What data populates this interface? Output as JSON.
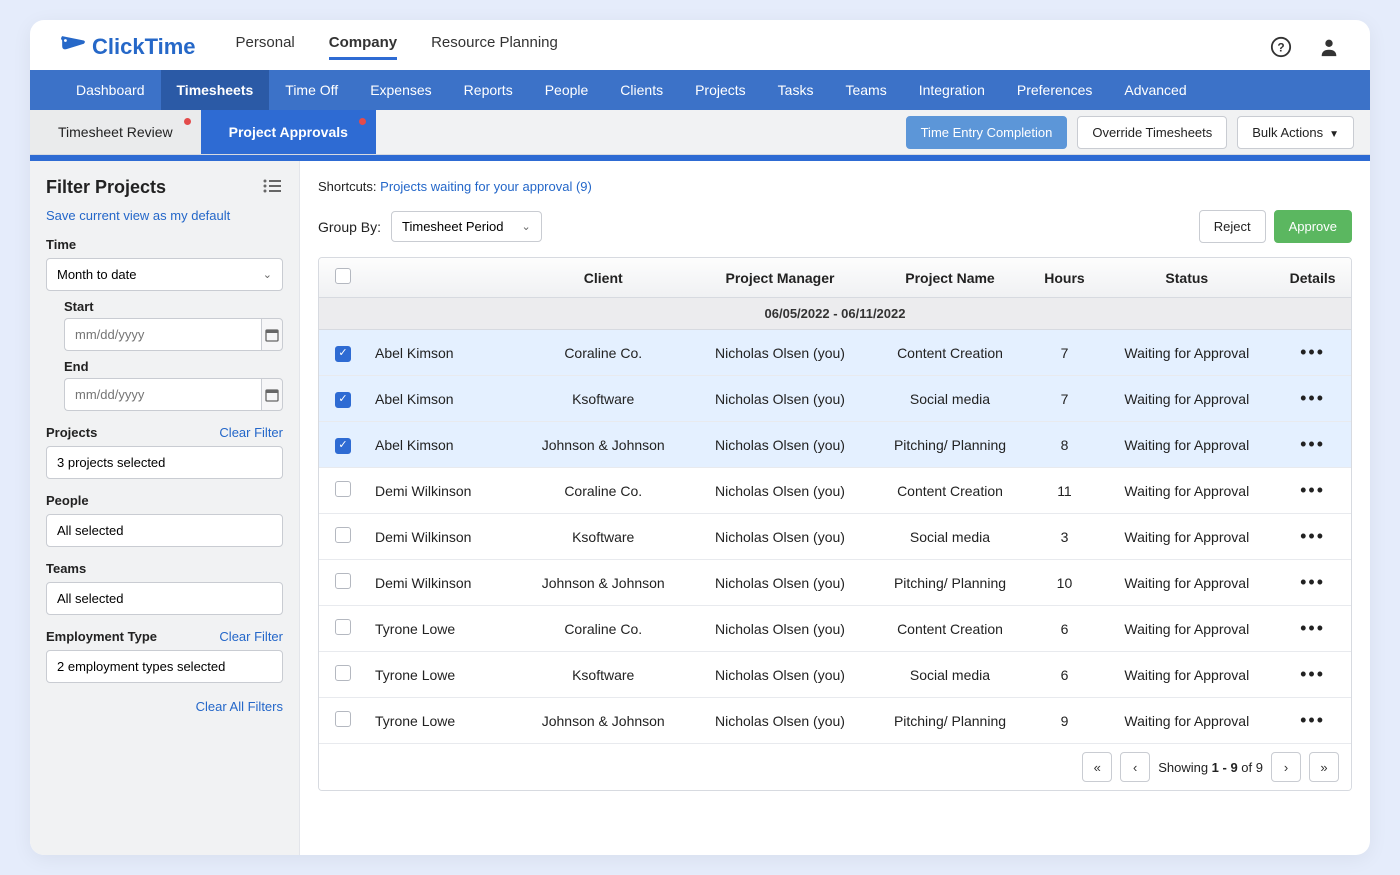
{
  "brand": "ClickTime",
  "topNav": {
    "items": [
      "Personal",
      "Company",
      "Resource Planning"
    ],
    "activeIndex": 1
  },
  "topIcons": {
    "help": "help-icon",
    "user": "user-icon"
  },
  "blueNav": {
    "items": [
      "Dashboard",
      "Timesheets",
      "Time Off",
      "Expenses",
      "Reports",
      "People",
      "Clients",
      "Projects",
      "Tasks",
      "Teams",
      "Integration",
      "Preferences",
      "Advanced"
    ],
    "activeIndex": 1
  },
  "subTabs": {
    "items": [
      {
        "label": "Timesheet Review",
        "hasDot": true
      },
      {
        "label": "Project Approvals",
        "hasDot": true
      }
    ],
    "activeIndex": 1,
    "actions": {
      "timeEntry": "Time Entry Completion",
      "override": "Override Timesheets",
      "bulk": "Bulk Actions"
    }
  },
  "sidebar": {
    "title": "Filter Projects",
    "saveView": "Save current view as my default",
    "time": {
      "label": "Time",
      "value": "Month to date",
      "start": {
        "label": "Start",
        "placeholder": "mm/dd/yyyy"
      },
      "end": {
        "label": "End",
        "placeholder": "mm/dd/yyyy"
      }
    },
    "projects": {
      "label": "Projects",
      "clear": "Clear Filter",
      "value": "3 projects selected"
    },
    "people": {
      "label": "People",
      "value": "All selected"
    },
    "teams": {
      "label": "Teams",
      "value": "All selected"
    },
    "employment": {
      "label": "Employment Type",
      "clear": "Clear Filter",
      "value": "2 employment types selected"
    },
    "clearAll": "Clear All Filters"
  },
  "main": {
    "shortcuts": {
      "label": "Shortcuts:",
      "link": "Projects waiting for your approval (9)"
    },
    "groupBy": {
      "label": "Group By:",
      "value": "Timesheet Period"
    },
    "buttons": {
      "reject": "Reject",
      "approve": "Approve"
    },
    "columns": [
      "",
      "",
      "Client",
      "Project Manager",
      "Project Name",
      "Hours",
      "Status",
      "Details"
    ],
    "groupHeader": "06/05/2022 - 06/11/2022",
    "rows": [
      {
        "selected": true,
        "person": "Abel Kimson",
        "client": "Coraline Co.",
        "manager": "Nicholas Olsen (you)",
        "project": "Content Creation",
        "hours": "7",
        "status": "Waiting for Approval"
      },
      {
        "selected": true,
        "person": "Abel Kimson",
        "client": "Ksoftware",
        "manager": "Nicholas Olsen (you)",
        "project": "Social media",
        "hours": "7",
        "status": "Waiting for Approval"
      },
      {
        "selected": true,
        "person": "Abel Kimson",
        "client": "Johnson & Johnson",
        "manager": "Nicholas Olsen (you)",
        "project": "Pitching/ Planning",
        "hours": "8",
        "status": "Waiting for Approval"
      },
      {
        "selected": false,
        "person": "Demi Wilkinson",
        "client": "Coraline Co.",
        "manager": "Nicholas Olsen (you)",
        "project": "Content Creation",
        "hours": "11",
        "status": "Waiting for Approval"
      },
      {
        "selected": false,
        "person": "Demi Wilkinson",
        "client": "Ksoftware",
        "manager": "Nicholas Olsen (you)",
        "project": "Social media",
        "hours": "3",
        "status": "Waiting for Approval"
      },
      {
        "selected": false,
        "person": "Demi Wilkinson",
        "client": "Johnson & Johnson",
        "manager": "Nicholas Olsen (you)",
        "project": "Pitching/ Planning",
        "hours": "10",
        "status": "Waiting for Approval"
      },
      {
        "selected": false,
        "person": "Tyrone Lowe",
        "client": "Coraline Co.",
        "manager": "Nicholas Olsen (you)",
        "project": "Content Creation",
        "hours": "6",
        "status": "Waiting for Approval"
      },
      {
        "selected": false,
        "person": "Tyrone Lowe",
        "client": "Ksoftware",
        "manager": "Nicholas Olsen (you)",
        "project": "Social media",
        "hours": "6",
        "status": "Waiting for Approval"
      },
      {
        "selected": false,
        "person": "Tyrone Lowe",
        "client": "Johnson & Johnson",
        "manager": "Nicholas Olsen (you)",
        "project": "Pitching/ Planning",
        "hours": "9",
        "status": "Waiting for Approval"
      }
    ],
    "pagination": {
      "text_prefix": "Showing ",
      "range": "1 - 9",
      "text_middle": " of ",
      "total": "9"
    }
  }
}
